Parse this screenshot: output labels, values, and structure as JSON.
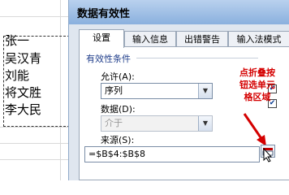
{
  "sheet": {
    "cells": [
      "张一",
      "吴汉青",
      "刘能",
      "将文胜",
      "李大民"
    ]
  },
  "dialog": {
    "title": "数据有效性",
    "tabs": [
      "设置",
      "输入信息",
      "出错警告",
      "输入法模式"
    ],
    "section_label": "有效性条件",
    "allow_label": "允许(A):",
    "allow_value": "序列",
    "data_label": "数据(D):",
    "data_value": "介于",
    "source_label": "来源(S):",
    "source_value": "=$B$4:$B$8",
    "annotation": [
      "点折叠按",
      "钮选单元",
      "格区域"
    ]
  },
  "colors": {
    "annotation": "#d40000",
    "section_label": "#1f3d8a",
    "title_bar": "#8ab0de"
  }
}
